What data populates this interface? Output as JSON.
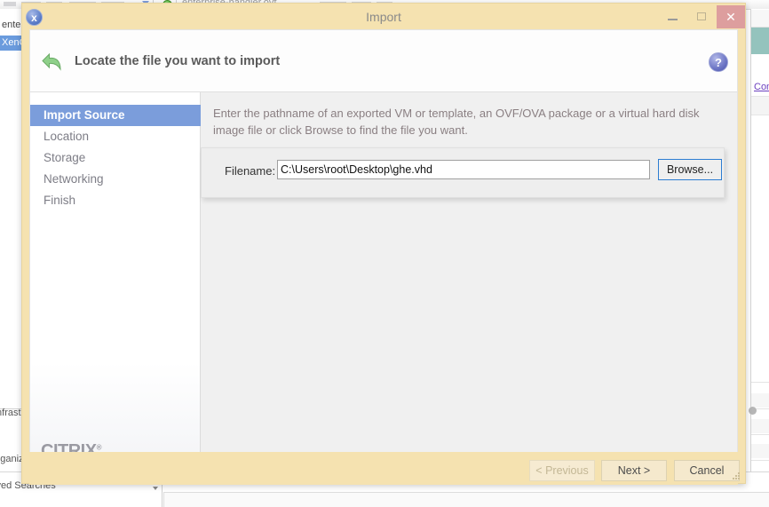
{
  "background_app": {
    "tab_label": "enterprise-handler.ovf",
    "tree_items": [
      {
        "label": "enterprise",
        "selected": false
      },
      {
        "label": "XenCenter",
        "selected": true
      }
    ],
    "tree_mid_label": "Infrastructure",
    "tree_label_objects": "Organization",
    "tree_label_searches": "Saved Searches",
    "link_label": "Console",
    "accent_teal": "#94c3bd",
    "accent_link": "#6b3fbf",
    "selection_blue": "#6a9bdd"
  },
  "dialog": {
    "title": "Import",
    "title_icon": "xencenter-logo-icon",
    "window_controls": {
      "minimize": "minimize-icon",
      "maximize": "maximize-icon",
      "close_label": "✕"
    },
    "header": {
      "title": "Locate the file you want to import",
      "back_icon": "back-arrow-icon",
      "help_label": "?"
    },
    "sidebar": {
      "items": [
        {
          "label": "Import Source",
          "active": true
        },
        {
          "label": "Location",
          "active": false
        },
        {
          "label": "Storage",
          "active": false
        },
        {
          "label": "Networking",
          "active": false
        },
        {
          "label": "Finish",
          "active": false
        }
      ],
      "brand": "CITRIX",
      "brand_mark": "®"
    },
    "content": {
      "description": "Enter the pathname of an exported VM or template, an OVF/OVA package or a virtual hard disk image file or click Browse to find the file you want.",
      "filename_label": "Filename:",
      "filename_value": "C:\\Users\\root\\Desktop\\ghe.vhd",
      "filename_placeholder": "",
      "browse_label": "Browse..."
    },
    "footer": {
      "previous_label": "< Previous",
      "next_label": "Next >",
      "cancel_label": "Cancel"
    },
    "colors": {
      "chrome": "#f5e2b0",
      "close_button": "#dd9e9e",
      "sidebar_active": "#7b9ddb",
      "content_bg": "#f0f0f0",
      "browse_focus_border": "#2d7dd2"
    }
  }
}
